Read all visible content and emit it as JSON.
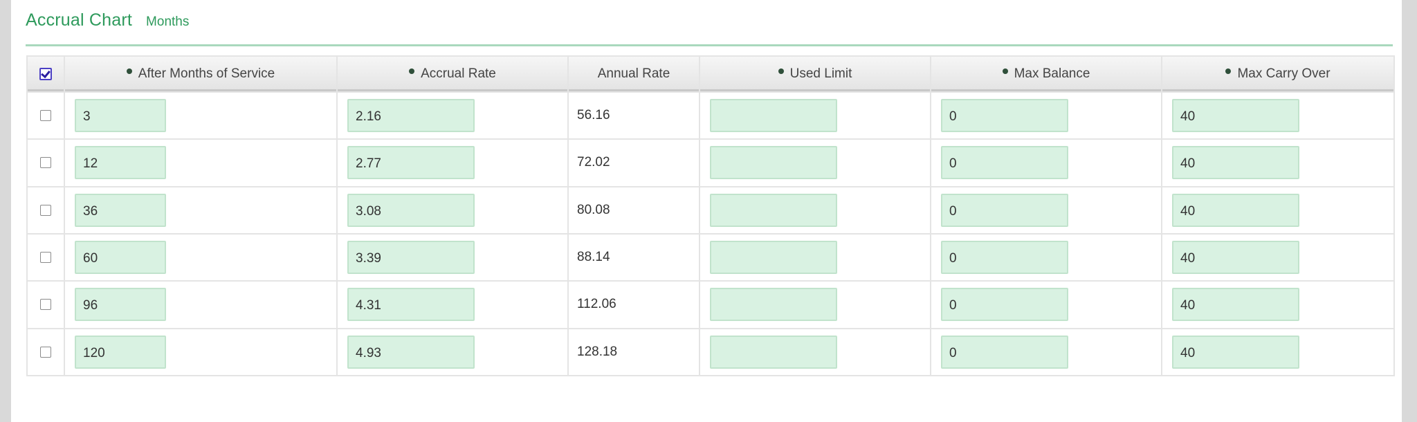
{
  "header": {
    "title": "Accrual Chart",
    "subtitle": "Months"
  },
  "table": {
    "columns": [
      {
        "label": "After Months of Service",
        "required": true
      },
      {
        "label": "Accrual Rate",
        "required": true
      },
      {
        "label": "Annual Rate",
        "required": false
      },
      {
        "label": "Used Limit",
        "required": true
      },
      {
        "label": "Max Balance",
        "required": true
      },
      {
        "label": "Max Carry Over",
        "required": true
      }
    ],
    "select_all_checked": true,
    "rows": [
      {
        "after_months": "3",
        "accrual_rate": "2.16",
        "annual_rate": "56.16",
        "used_limit": "",
        "max_balance": "0",
        "max_carry_over": "40"
      },
      {
        "after_months": "12",
        "accrual_rate": "2.77",
        "annual_rate": "72.02",
        "used_limit": "",
        "max_balance": "0",
        "max_carry_over": "40"
      },
      {
        "after_months": "36",
        "accrual_rate": "3.08",
        "annual_rate": "80.08",
        "used_limit": "",
        "max_balance": "0",
        "max_carry_over": "40"
      },
      {
        "after_months": "60",
        "accrual_rate": "3.39",
        "annual_rate": "88.14",
        "used_limit": "",
        "max_balance": "0",
        "max_carry_over": "40"
      },
      {
        "after_months": "96",
        "accrual_rate": "4.31",
        "annual_rate": "112.06",
        "used_limit": "",
        "max_balance": "0",
        "max_carry_over": "40"
      },
      {
        "after_months": "120",
        "accrual_rate": "4.93",
        "annual_rate": "128.18",
        "used_limit": "",
        "max_balance": "0",
        "max_carry_over": "40"
      }
    ]
  },
  "colors": {
    "accent": "#2e9a5c",
    "field_bg": "#d9f2e2",
    "checkbox_accent": "#4b3fc4"
  }
}
